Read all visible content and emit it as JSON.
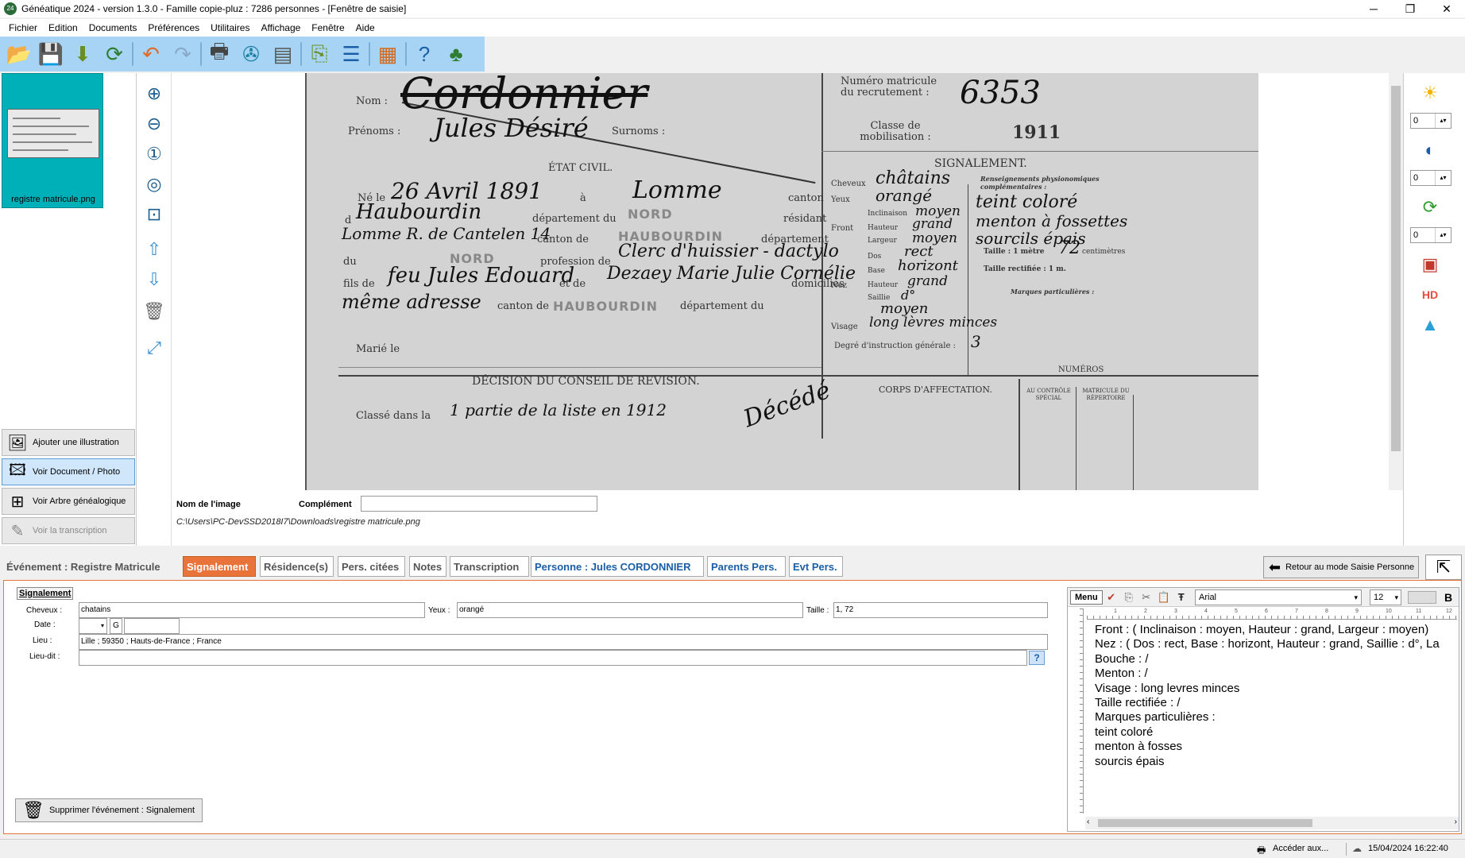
{
  "window": {
    "title": "Généatique 2024 - version 1.3.0 - Famille copie-pluz : 7286 personnes - [Fenêtre de saisie]",
    "minimize": "─",
    "maximize": "❐",
    "close": "✕"
  },
  "menu": [
    "Fichier",
    "Edition",
    "Documents",
    "Préférences",
    "Utilitaires",
    "Affichage",
    "Fenêtre",
    "Aide"
  ],
  "toolbar_icons": [
    "open-folder-icon",
    "save-icon",
    "import-icon",
    "sync-icon",
    "undo-icon",
    "redo-icon",
    "print-icon",
    "tools-icon",
    "report-icon",
    "export-icon",
    "list-icon",
    "grid-icon",
    "help-icon",
    "tree-icon"
  ],
  "thumbnail": {
    "label": "registre matricule.png"
  },
  "side_buttons": {
    "add_illustration": "Ajouter une illustration",
    "view_document": "Voir Document / Photo",
    "view_tree": "Voir Arbre généalogique",
    "view_transcription": "Voir la transcription"
  },
  "document": {
    "nom_label": "Nom :",
    "nom_value": "Cordonnier",
    "prenoms_label": "Prénoms :",
    "prenoms_value": "Jules Désiré",
    "surnoms_label": "Surnoms :",
    "matricule_label": "Numéro matricule du recrutement :",
    "matricule_value": "6353",
    "classe_label": "Classe de mobilisation :",
    "classe_value": "1911",
    "etat_civil": "ÉTAT CIVIL.",
    "signalement": "SIGNALEMENT.",
    "ne_le": "Né le",
    "birth_date": "26 Avril 1891",
    "a": "à",
    "birth_place": "Lomme",
    "canton": "canton",
    "d": "d",
    "canton_value": "Haubourdin",
    "departement_du": "département du",
    "stamp_nord": "NORD",
    "residant": "résidant",
    "address": "Lomme R. de Cantelen 14",
    "canton_de": "canton de",
    "stamp_haubourdin": "HAUBOURDIN",
    "departement": "département",
    "du": "du",
    "profession_de": "profession de",
    "profession": "Clerc d'huissier - dactylo",
    "fils_de": "fils de",
    "father": "feu Jules Edouard",
    "et_de": "et de",
    "mother": "Dezaey Marie Julie Cornélie",
    "domicilies": "domiciliés",
    "meme_adresse": "même adresse",
    "marie": "Marié le",
    "decision": "DÉCISION DU CONSEIL DE REVISION.",
    "classe_dans": "Classé dans la",
    "partie": "1 partie de la liste en 1912",
    "decede": "Décédé",
    "corps": "CORPS D'AFFECTATION.",
    "numeros": "NUMÉROS",
    "au_controle": "AU CONTRÔLE SPÉCIAL",
    "matricule_au_repertoire": "MATRICULE DU RÉPERTOIRE",
    "cheveux_label": "Cheveux",
    "cheveux_value": "châtains",
    "yeux_label": "Yeux",
    "yeux_value": "orangé",
    "front_label": "Front",
    "inclinaison_label": "Inclinaison",
    "inclinaison_value": "moyen",
    "hauteur_label": "Hauteur",
    "hauteur_value": "grand",
    "largeur_label": "Largeur",
    "largeur_value": "moyen",
    "dos_label": "Dos",
    "dos_value": "rect",
    "base_label": "Base",
    "base_value": "horizont",
    "nez_label": "Nez",
    "nez_hauteur_value": "grand",
    "saillie_label": "Saillie",
    "saillie_value": "d°",
    "bouche_value": "moyen",
    "visage_label": "Visage",
    "visage_value": "long lèvres minces",
    "degre_label": "Degré d'instruction générale :",
    "degre_value": "3",
    "renseignements": "Renseignements physionomiques complémentaires :",
    "teint": "teint coloré",
    "menton": "menton à fossettes",
    "sourcils": "sourcils épais",
    "taille_label": "Taille : 1 mètre",
    "taille_value": "72",
    "centimetres": "centimètres",
    "taille_rect_label": "Taille rectifiée : 1 m.",
    "marques_label": "Marques particulières :"
  },
  "image_info": {
    "nom_label": "Nom de l'image",
    "complement_label": "Complément",
    "complement_value": "",
    "path": "C:\\Users\\PC-DevSSD2018I7\\Downloads\\registre matricule.png"
  },
  "right_tools": {
    "brightness": "0",
    "contrast": "0",
    "rotation": "0"
  },
  "tabs": {
    "evenement": "Événement : Registre Matricule",
    "signalement": "Signalement",
    "residences": "Résidence(s)",
    "pers_citees": "Pers. citées",
    "notes": "Notes",
    "transcription": "Transcription",
    "personne": "Personne : Jules CORDONNIER",
    "parents": "Parents Pers.",
    "evt": "Evt Pers.",
    "retour": "Retour au mode Saisie Personne"
  },
  "form": {
    "section": "Signalement",
    "cheveux_label": "Cheveux :",
    "cheveux_value": "chatains",
    "yeux_label": "Yeux :",
    "yeux_value": "orangé",
    "taille_label": "Taille :",
    "taille_value": "1, 72",
    "date_label": "Date :",
    "date_qualifier": "",
    "date_calendar": "G",
    "date_value": "",
    "lieu_label": "Lieu :",
    "lieu_value": "Lille ; 59350 ; Hauts-de-France ; France",
    "lieudit_label": "Lieu-dit :",
    "lieudit_value": "",
    "help": "?",
    "delete": "Supprimer l'événement : Signalement"
  },
  "editor": {
    "menu": "Menu",
    "font": "Arial",
    "size": "12",
    "bold": "B",
    "lines": [
      "Front : ( Inclinaison : moyen, Hauteur : grand, Largeur : moyen)",
      "Nez : ( Dos : rect, Base : horizont, Hauteur : grand, Saillie : d°, La",
      "Bouche : /",
      "Menton : /",
      "Visage : long levres minces",
      "Taille rectifiée : /",
      "Marques particulières :",
      "teint coloré",
      "menton à fosses",
      "sourcis épais"
    ],
    "ruler": [
      "1",
      "2",
      "3",
      "4",
      "5",
      "6",
      "7",
      "8",
      "9",
      "10",
      "11",
      "12"
    ]
  },
  "status": {
    "acceder": "Accéder aux...",
    "datetime": "15/04/2024 16:22:40"
  }
}
